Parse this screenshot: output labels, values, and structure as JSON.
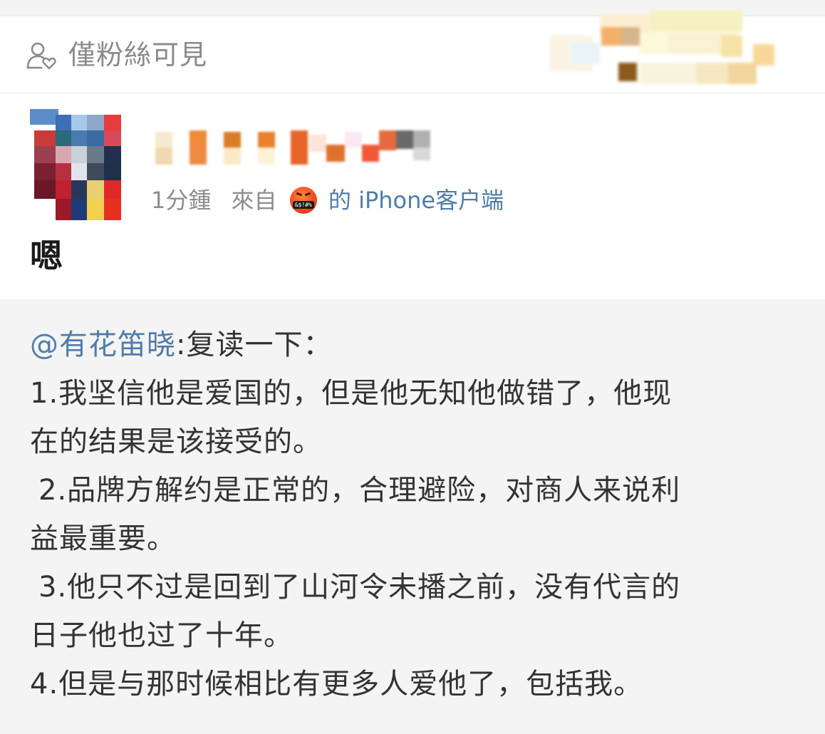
{
  "visibility": {
    "icon": "user-heart-icon",
    "label": "僅粉絲可見"
  },
  "post": {
    "time": "1分鍾",
    "source_prefix": "來自",
    "source_emoji": "angry-face-with-symbols-icon",
    "source_emoji_text": "&$!#%",
    "source_client": "的 iPhone客户端",
    "text": "嗯"
  },
  "repost": {
    "mention": "@有花笛晓",
    "intro": ":复读一下：",
    "lines": [
      "1.我坚信他是爱国的，但是他无知他做错了，他现",
      "在的结果是该接受的。",
      "2.品牌方解约是正常的，合理避险，对商人来说利",
      "益最重要。",
      "3.他只不过是回到了山河令未播之前，没有代言的",
      "日子他也过了十年。",
      "4.但是与那时候相比有更多人爱他了，包括我。"
    ]
  },
  "colors": {
    "link_blue": "#4f7ca9",
    "muted_gray": "#8d8d8d",
    "repost_background": "#f4f4f4"
  }
}
